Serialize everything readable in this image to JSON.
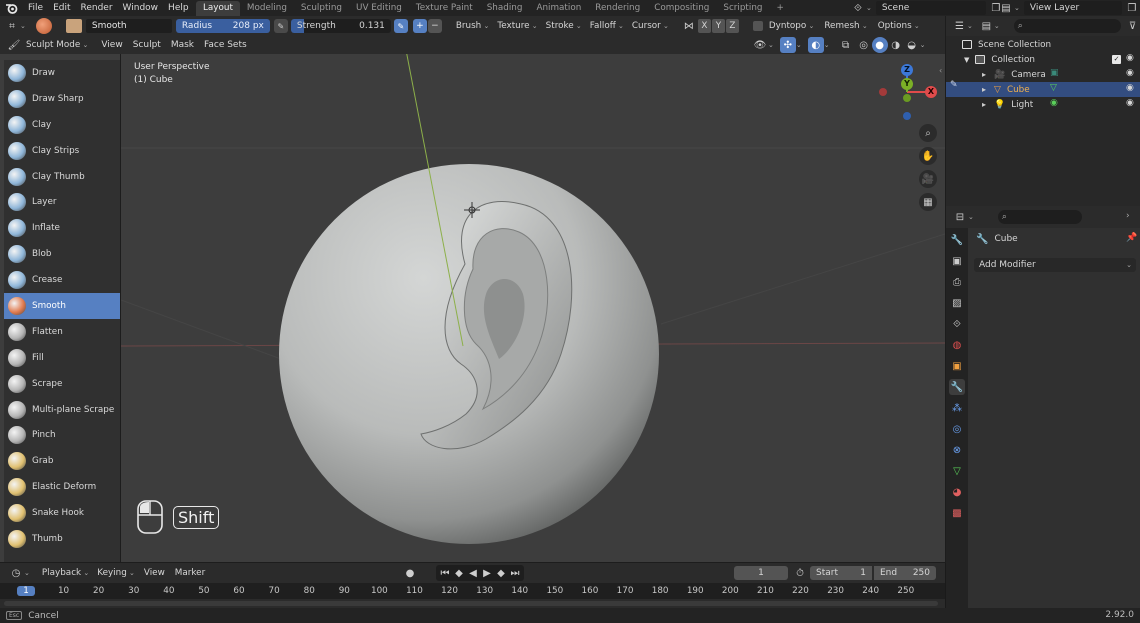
{
  "topbar": {
    "menus": [
      "File",
      "Edit",
      "Render",
      "Window",
      "Help"
    ],
    "workspaces": [
      "Layout",
      "Modeling",
      "Sculpting",
      "UV Editing",
      "Texture Paint",
      "Shading",
      "Animation",
      "Rendering",
      "Compositing",
      "Scripting"
    ],
    "active_workspace": "Layout",
    "add_tab": "+",
    "scene_label": "Scene",
    "view_layer_label": "View Layer"
  },
  "tool_header": {
    "brush_name": "Smooth",
    "radius_label": "Radius",
    "radius_value": "208 px",
    "strength_label": "Strength",
    "strength_value": "0.131",
    "plus": "+",
    "minus": "−",
    "dropdowns": [
      "Brush",
      "Texture",
      "Stroke",
      "Falloff",
      "Cursor"
    ],
    "axes": [
      "X",
      "Y",
      "Z"
    ],
    "dyntopo": "Dyntopo",
    "remesh": "Remesh",
    "options": "Options"
  },
  "viewport_header": {
    "mode": "Sculpt Mode",
    "menus": [
      "View",
      "Sculpt",
      "Mask",
      "Face Sets"
    ]
  },
  "viewport": {
    "perspective": "User Perspective",
    "object": "(1) Cube",
    "key_hint": "Shift",
    "gizmo": {
      "x": "X",
      "y": "Y",
      "z": "Z"
    }
  },
  "tools": [
    {
      "label": "Draw",
      "color": "#8fb6d9"
    },
    {
      "label": "Draw Sharp",
      "color": "#8fb6d9"
    },
    {
      "label": "Clay",
      "color": "#8fb6d9"
    },
    {
      "label": "Clay Strips",
      "color": "#8fb6d9"
    },
    {
      "label": "Clay Thumb",
      "color": "#8fb6d9"
    },
    {
      "label": "Layer",
      "color": "#8fb6d9"
    },
    {
      "label": "Inflate",
      "color": "#8fb6d9"
    },
    {
      "label": "Blob",
      "color": "#8fb6d9"
    },
    {
      "label": "Crease",
      "color": "#8fb6d9"
    },
    {
      "label": "Smooth",
      "color": "#e07a4e"
    },
    {
      "label": "Flatten",
      "color": "#b5b5b5"
    },
    {
      "label": "Fill",
      "color": "#b5b5b5"
    },
    {
      "label": "Scrape",
      "color": "#b5b5b5"
    },
    {
      "label": "Multi-plane Scrape",
      "color": "#b5b5b5"
    },
    {
      "label": "Pinch",
      "color": "#b5b5b5"
    },
    {
      "label": "Grab",
      "color": "#e0c070"
    },
    {
      "label": "Elastic Deform",
      "color": "#e0c070"
    },
    {
      "label": "Snake Hook",
      "color": "#e0c070"
    },
    {
      "label": "Thumb",
      "color": "#e0c070"
    }
  ],
  "active_tool": "Smooth",
  "outliner": {
    "scene_collection": "Scene Collection",
    "collection": "Collection",
    "items": [
      {
        "label": "Camera",
        "icon": "camera-icon",
        "selected": false
      },
      {
        "label": "Cube",
        "icon": "mesh-icon",
        "selected": true
      },
      {
        "label": "Light",
        "icon": "light-icon",
        "selected": false
      }
    ]
  },
  "properties": {
    "object_name": "Cube",
    "add_modifier": "Add Modifier"
  },
  "timeline": {
    "menus": [
      "Playback",
      "Keying",
      "View",
      "Marker"
    ],
    "current_frame": "1",
    "start_label": "Start",
    "start_value": "1",
    "end_label": "End",
    "end_value": "250",
    "frames": [
      "1",
      "10",
      "20",
      "30",
      "40",
      "50",
      "60",
      "70",
      "80",
      "90",
      "100",
      "110",
      "120",
      "130",
      "140",
      "150",
      "160",
      "170",
      "180",
      "190",
      "200",
      "210",
      "220",
      "230",
      "240",
      "250"
    ]
  },
  "statusbar": {
    "left": "Cancel",
    "version": "2.92.0"
  },
  "colors": {
    "accent": "#5680c2",
    "selected_row": "#334d80",
    "x_axis": "#e04b4b",
    "y_axis": "#7bb026",
    "z_axis": "#3c78d8"
  }
}
